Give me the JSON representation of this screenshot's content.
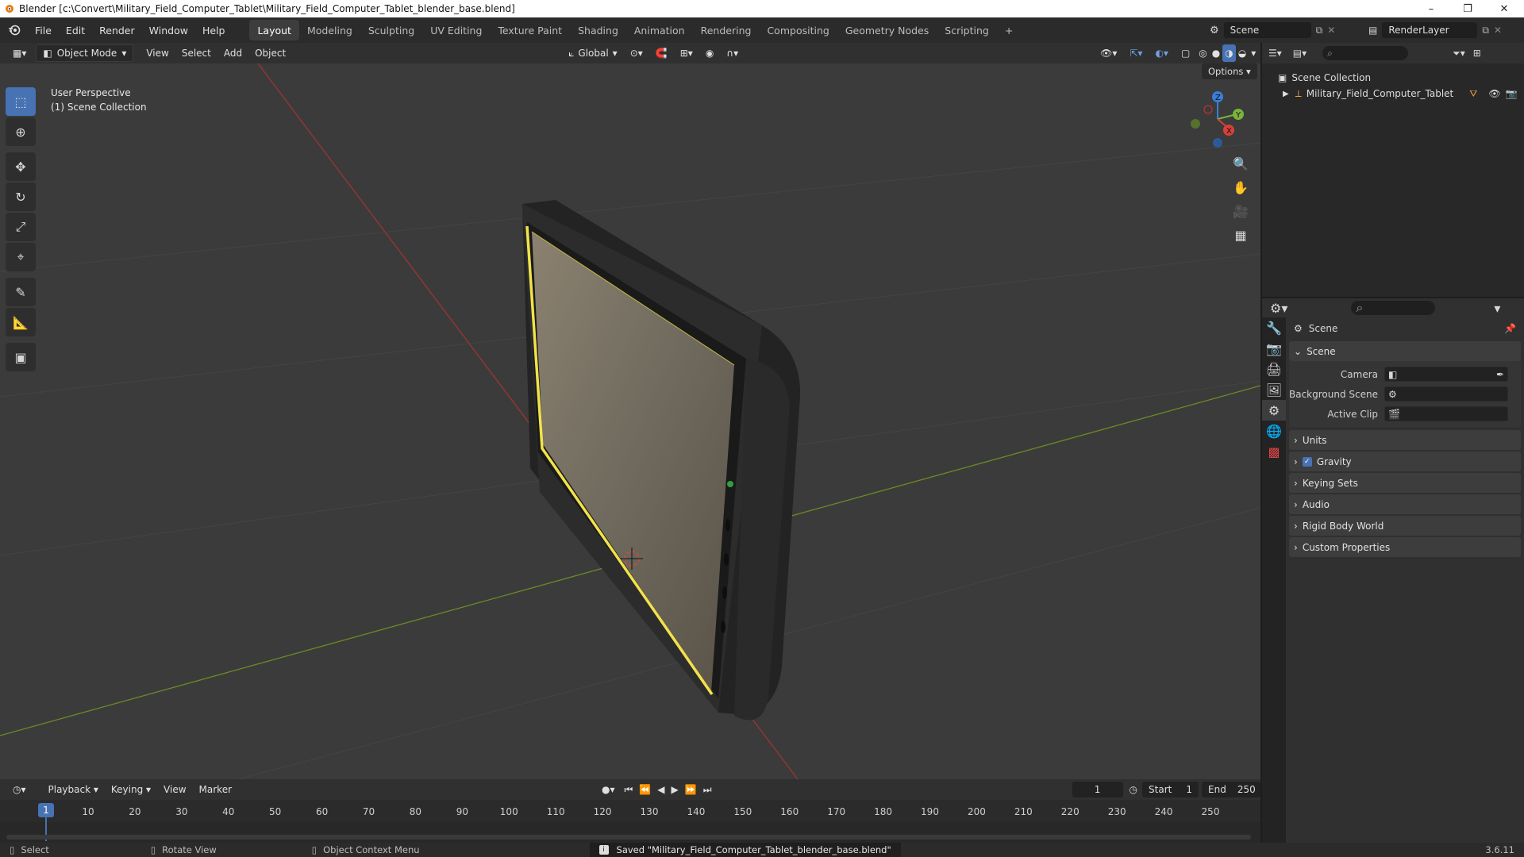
{
  "window": {
    "title": "Blender [c:\\Convert\\Military_Field_Computer_Tablet\\Military_Field_Computer_Tablet_blender_base.blend]",
    "controls": [
      "–",
      "❐",
      "✕"
    ]
  },
  "menus": [
    "File",
    "Edit",
    "Render",
    "Window",
    "Help"
  ],
  "workspaces": [
    "Layout",
    "Modeling",
    "Sculpting",
    "UV Editing",
    "Texture Paint",
    "Shading",
    "Animation",
    "Rendering",
    "Compositing",
    "Geometry Nodes",
    "Scripting"
  ],
  "active_workspace": "Layout",
  "add_workspace": "+",
  "scene_selector": "Scene",
  "renderlayer_selector": "RenderLayer",
  "viewport_header": {
    "mode": "Object Mode",
    "menus": [
      "View",
      "Select",
      "Add",
      "Object"
    ],
    "orientation": "Global"
  },
  "viewport": {
    "perspective": "User Perspective",
    "collection": "(1) Scene Collection",
    "options": "Options",
    "accent": "#4772b3",
    "outline_color": "#f2e24b"
  },
  "gizmo": {
    "x": "X",
    "y": "Y",
    "z": "Z"
  },
  "outliner": {
    "root": "Scene Collection",
    "item": "Military_Field_Computer_Tablet"
  },
  "properties": {
    "context": "Scene",
    "panel_title": "Scene",
    "fields": [
      {
        "label": "Camera"
      },
      {
        "label": "Background Scene"
      },
      {
        "label": "Active Clip"
      }
    ],
    "panels": [
      "Units",
      "Gravity",
      "Keying Sets",
      "Audio",
      "Rigid Body World",
      "Custom Properties"
    ],
    "gravity_checked": true
  },
  "timeline": {
    "menus": [
      "Playback",
      "Keying",
      "View",
      "Marker"
    ],
    "current_frame": "1",
    "start_label": "Start",
    "start": "1",
    "end_label": "End",
    "end": "250",
    "ticks": [
      "1",
      "10",
      "20",
      "30",
      "40",
      "50",
      "60",
      "70",
      "80",
      "90",
      "100",
      "110",
      "120",
      "130",
      "140",
      "150",
      "160",
      "170",
      "180",
      "190",
      "200",
      "210",
      "220",
      "230",
      "240",
      "250"
    ]
  },
  "statusbar": {
    "select": "Select",
    "rotate": "Rotate View",
    "context_menu": "Object Context Menu",
    "message": "Saved \"Military_Field_Computer_Tablet_blender_base.blend\"",
    "version": "3.6.11"
  }
}
